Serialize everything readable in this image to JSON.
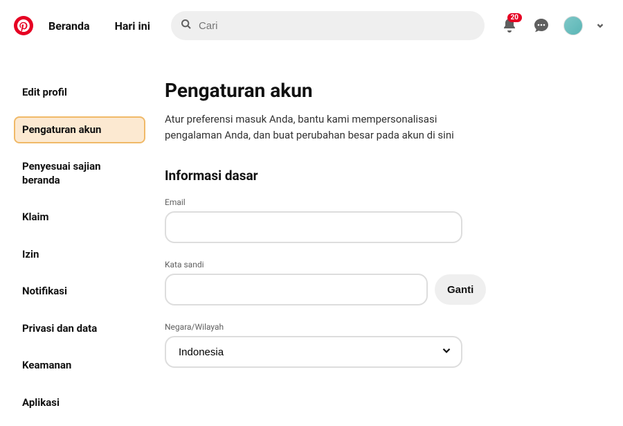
{
  "header": {
    "nav": {
      "home": "Beranda",
      "today": "Hari ini"
    },
    "search_placeholder": "Cari",
    "notification_count": "20"
  },
  "sidebar": {
    "items": [
      {
        "label": "Edit profil"
      },
      {
        "label": "Pengaturan akun"
      },
      {
        "label": "Penyesuai sajian beranda"
      },
      {
        "label": "Klaim"
      },
      {
        "label": "Izin"
      },
      {
        "label": "Notifikasi"
      },
      {
        "label": "Privasi dan data"
      },
      {
        "label": "Keamanan"
      },
      {
        "label": "Aplikasi"
      }
    ]
  },
  "main": {
    "title": "Pengaturan akun",
    "subtitle": "Atur preferensi masuk Anda, bantu kami mempersonalisasi pengalaman Anda, dan buat perubahan besar pada akun di sini",
    "section_basic": "Informasi dasar",
    "email_label": "Email",
    "email_value": "",
    "password_label": "Kata sandi",
    "password_value": "",
    "change_button": "Ganti",
    "country_label": "Negara/Wilayah",
    "country_value": "Indonesia"
  }
}
